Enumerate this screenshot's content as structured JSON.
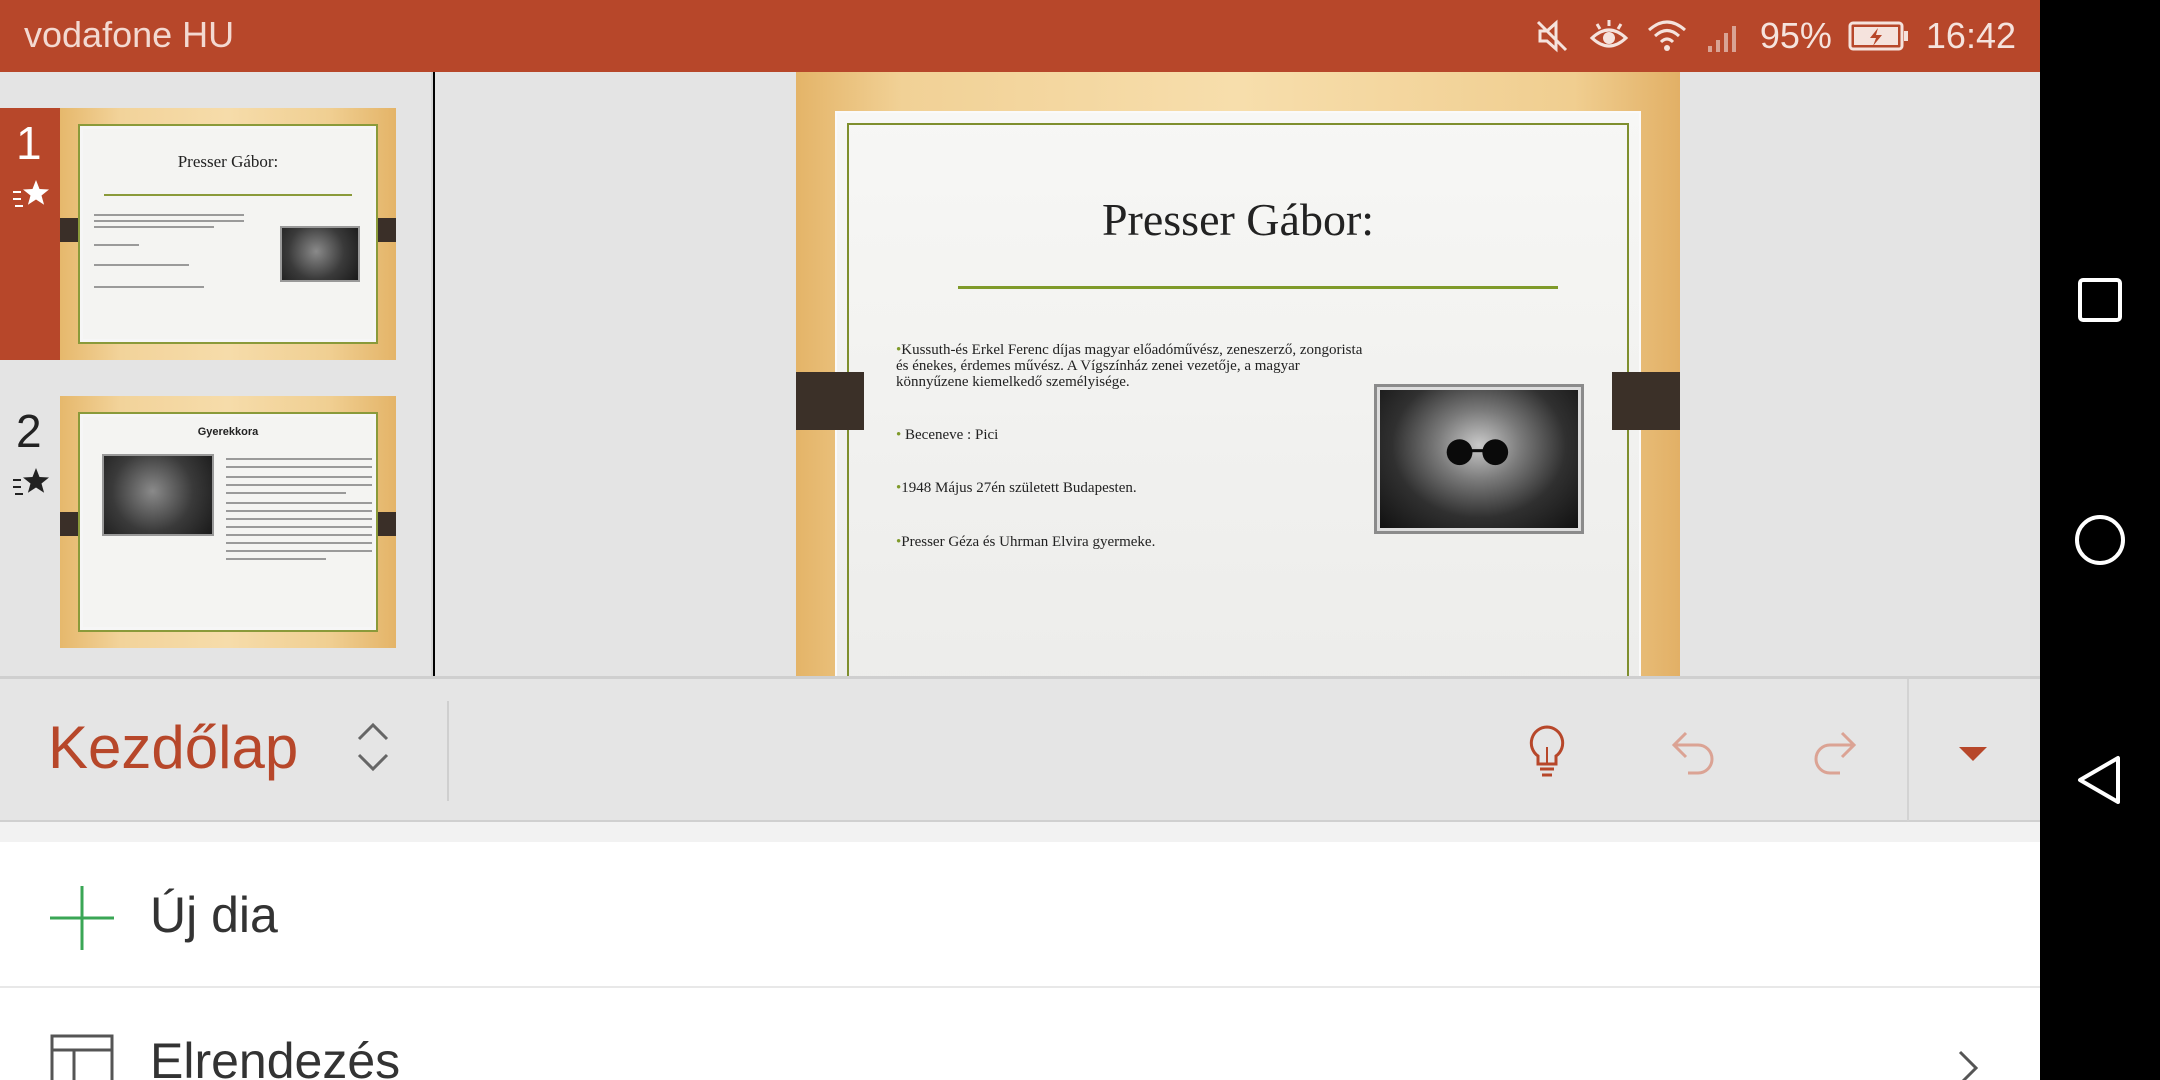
{
  "status_bar": {
    "carrier": "vodafone HU",
    "battery": "95%",
    "time": "16:42",
    "icons": [
      "mute-icon",
      "eye-comfort-icon",
      "wifi-icon",
      "signal-icon",
      "battery-charging-icon"
    ]
  },
  "thumbnails": [
    {
      "number": "1",
      "title": "Presser Gábor:",
      "selected": true
    },
    {
      "number": "2",
      "title": "Gyerekkora",
      "selected": false
    }
  ],
  "slide": {
    "title": "Presser Gábor:",
    "bullets": [
      "Kussuth-és Erkel Ferenc díjas magyar előadóművész, zeneszerző, zongorista és énekes, érdemes művész.  A Vígszínház zenei vezetője, a magyar könnyűzene kiemelkedő személyisége.",
      " Beceneve : Pici",
      "1948 Május 27én született Budapesten.",
      "Presser Géza és Uhrman Elvira  gyermeke."
    ]
  },
  "ribbon": {
    "tab_label": "Kezdőlap",
    "icons": [
      "lightbulb-icon",
      "undo-icon",
      "redo-icon",
      "collapse-ribbon-icon"
    ]
  },
  "commands": [
    {
      "label": "Új dia",
      "icon": "plus-icon"
    },
    {
      "label": "Elrendezés",
      "icon": "layout-icon"
    }
  ],
  "colors": {
    "accent": "#b7472a",
    "slide_rule": "#7f9a2a",
    "new_slide_plus": "#3aa655"
  }
}
